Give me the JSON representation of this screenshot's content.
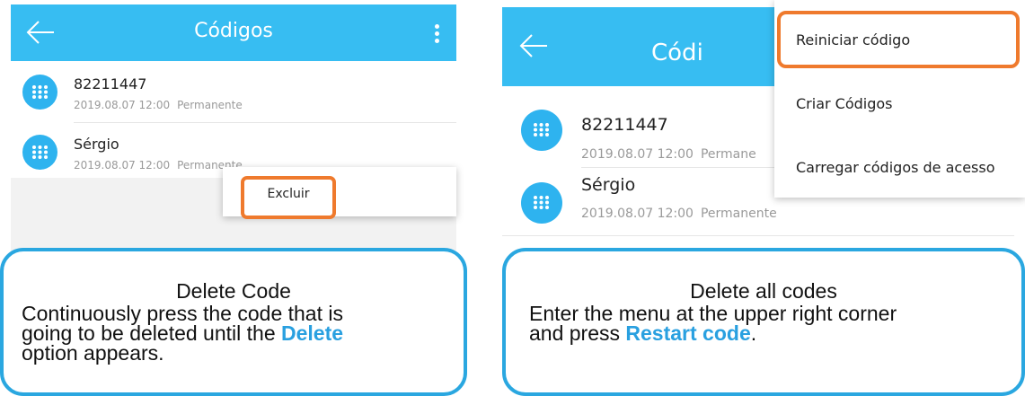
{
  "left": {
    "header_title": "Códigos",
    "items": [
      {
        "name": "82211447",
        "datetime": "2019.08.07 12:00",
        "validity": "Permanente"
      },
      {
        "name": "Sérgio",
        "datetime": "2019.08.07 12:00",
        "validity": "Permanente"
      }
    ],
    "context_menu": {
      "delete_label": "Excluir"
    },
    "callout": {
      "title": "Delete Code",
      "line1": "Continuously press the code that is",
      "line2_prefix": "going to be deleted until the",
      "line2_keyword": "Delete",
      "line3": "option appears."
    }
  },
  "right": {
    "header_title": "Códi",
    "items": [
      {
        "name": "82211447",
        "datetime": "2019.08.07 12:00",
        "validity": "Permane"
      },
      {
        "name": "Sérgio",
        "datetime": "2019.08.07 12:00",
        "validity": "Permanente"
      }
    ],
    "menu": {
      "items": [
        "Reiniciar código",
        "Criar Códigos",
        "Carregar códigos de acesso"
      ]
    },
    "callout": {
      "title": "Delete all codes",
      "line1": "Enter the menu at the upper right corner",
      "line2_prefix": "and press",
      "line2_keyword": "Restart code",
      "line2_suffix": "."
    }
  },
  "colors": {
    "header": "#37bdf2",
    "icon": "#2eb3ef",
    "highlight": "#ef7a2d",
    "callout_border": "#2aa7e0",
    "keyword": "#29a0e0"
  },
  "icons": {
    "back": "arrow-left-icon",
    "more": "kebab-menu-icon",
    "item": "keypad-icon"
  }
}
